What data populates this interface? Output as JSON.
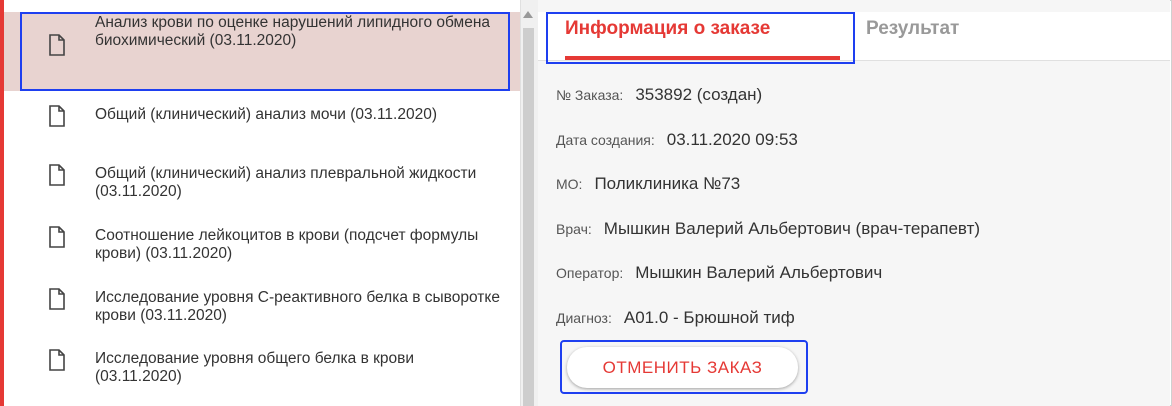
{
  "orders": [
    {
      "label": "Анализ крови по оценке нарушений липидного обмена биохимический (03.11.2020)",
      "selected": true
    },
    {
      "label": "Общий (клинический) анализ мочи (03.11.2020)",
      "selected": false
    },
    {
      "label": "Общий (клинический) анализ плевральной жидкости (03.11.2020)",
      "selected": false
    },
    {
      "label": "Соотношение лейкоцитов в крови (подсчет формулы крови) (03.11.2020)",
      "selected": false
    },
    {
      "label": "Исследование уровня С-реактивного белка в сыворотке крови (03.11.2020)",
      "selected": false
    },
    {
      "label": "Исследование уровня общего белка в крови (03.11.2020)",
      "selected": false
    }
  ],
  "tabs": {
    "info": "Информация о заказе",
    "result": "Результат"
  },
  "details": {
    "order_label": "№ Заказа:",
    "order_value": "353892 (создан)",
    "created_label": "Дата создания:",
    "created_value": "03.11.2020 09:53",
    "mo_label": "МО:",
    "mo_value": "Поликлиника №73",
    "doctor_label": "Врач:",
    "doctor_value": "Мышкин Валерий Альбертович (врач-терапевт)",
    "operator_label": "Оператор:",
    "operator_value": "Мышкин Валерий Альбертович",
    "diagnosis_label": "Диагноз:",
    "diagnosis_value": "A01.0 - Брюшной тиф"
  },
  "actions": {
    "cancel": "ОТМЕНИТЬ ЗАКАЗ"
  },
  "colors": {
    "accent": "#e53935",
    "highlight": "#1e3ff0",
    "selected_bg": "#e8d3d0"
  },
  "icons": {
    "list_item": "document-icon",
    "scroll": "scroll-up-arrow-icon"
  }
}
